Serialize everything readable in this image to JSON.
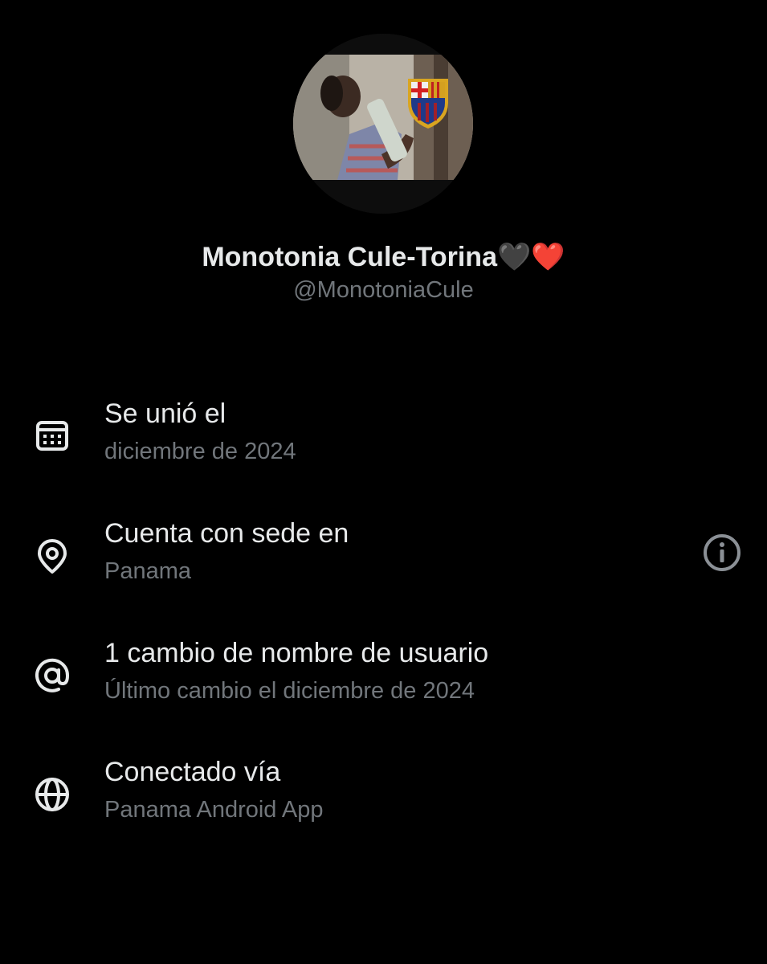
{
  "profile": {
    "display_name": "Monotonia Cule-Torina🖤❤️",
    "handle": "@MonotoniaCule",
    "avatar": "avatar-photo"
  },
  "about": {
    "items": [
      {
        "icon": "calendar-icon",
        "title": "Se unió el",
        "subtitle": "diciembre de 2024"
      },
      {
        "icon": "location-pin-icon",
        "title": "Cuenta con sede en",
        "subtitle": "Panama"
      },
      {
        "icon": "at-sign-icon",
        "title": "1 cambio de nombre de usuario",
        "subtitle": "Último cambio el diciembre de 2024"
      },
      {
        "icon": "globe-icon",
        "title": "Conectado vía",
        "subtitle": "Panama Android App"
      }
    ],
    "info_icon": "info-icon"
  },
  "colors": {
    "background": "#000000",
    "primary_text": "#e7e9ea",
    "secondary_text": "#71767b"
  }
}
